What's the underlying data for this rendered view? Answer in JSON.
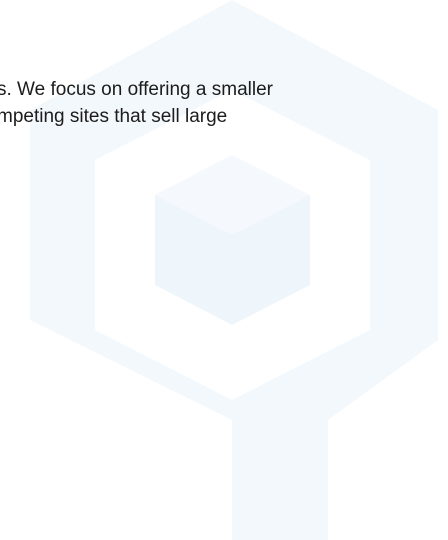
{
  "content": {
    "paragraph_lines": [
      "s. We focus on offering a smaller",
      "mpeting sites that sell large"
    ]
  },
  "watermark": {
    "icon": "hexagon-cube-logo-icon",
    "color": "#eef6fb"
  }
}
